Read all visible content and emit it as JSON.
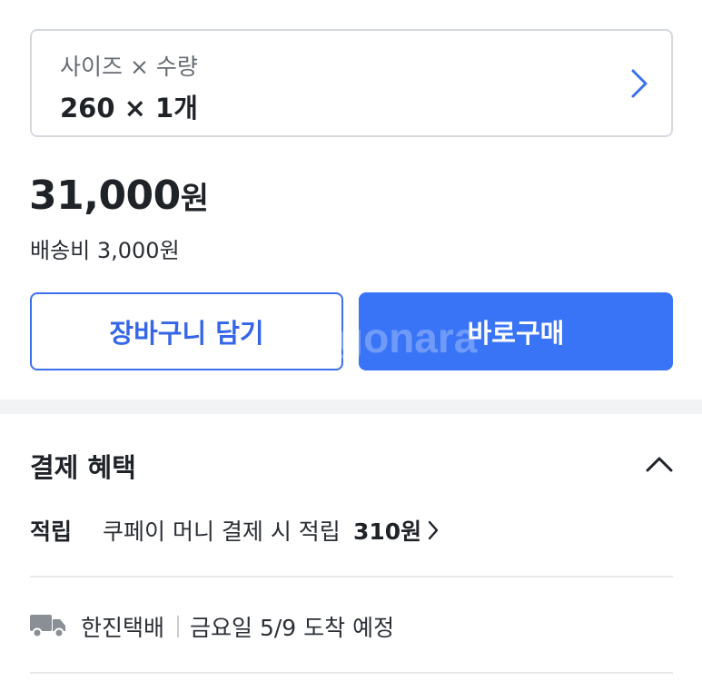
{
  "option": {
    "label": "사이즈 × 수량",
    "value": "260 × 1개"
  },
  "price": {
    "amount": "31,000",
    "unit": "원"
  },
  "shipping_fee": "배송비 3,000원",
  "buttons": {
    "cart": "장바구니 담기",
    "buy": "바로구매"
  },
  "watermark": "gonara",
  "payment_benefits": {
    "title": "결제 혜택",
    "reward_label": "적립",
    "reward_desc": "쿠페이 머니 결제 시 적립",
    "reward_amount": "310원"
  },
  "delivery": {
    "carrier": "한진택배",
    "eta": "금요일 5/9 도착 예정"
  },
  "colors": {
    "accent": "#3a74f6",
    "accent_text": "#3566e8",
    "divider": "#f1f3f5"
  },
  "icons": [
    "chevron-right-icon",
    "chevron-up-icon",
    "truck-icon"
  ]
}
